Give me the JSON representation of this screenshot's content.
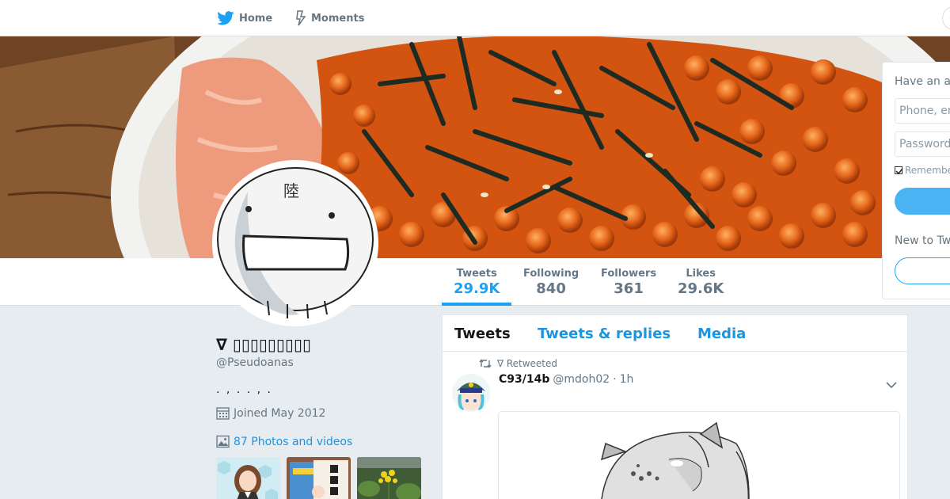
{
  "nav": {
    "home_label": "Home",
    "moments_label": "Moments"
  },
  "profile": {
    "name": "∇ ▯▯▯▯▯▯▯▯▯",
    "handle": "@Pseudoanas",
    "bio": ". , . . , .",
    "joined": "Joined May 2012",
    "photos_link": "87 Photos and videos",
    "avatar_char": "陸"
  },
  "stats": [
    {
      "label": "Tweets",
      "value": "29.9K"
    },
    {
      "label": "Following",
      "value": "840"
    },
    {
      "label": "Followers",
      "value": "361"
    },
    {
      "label": "Likes",
      "value": "29.6K"
    }
  ],
  "timeline": {
    "tabs": [
      "Tweets",
      "Tweets & replies",
      "Media"
    ],
    "retweet_text": "∇ Retweeted",
    "tweet": {
      "name": "C93/14b",
      "username": "@mdoh02",
      "separator": "·",
      "time": "1h"
    }
  },
  "login": {
    "title": "Have an account?",
    "phone_placeholder": "Phone, email or username",
    "password_placeholder": "Password",
    "remember": "Remember me",
    "new_text": "New to Twitter?"
  },
  "colors": {
    "accent": "#1da1f2",
    "link": "#1b95e0",
    "page_bg": "#e6ecf0"
  }
}
